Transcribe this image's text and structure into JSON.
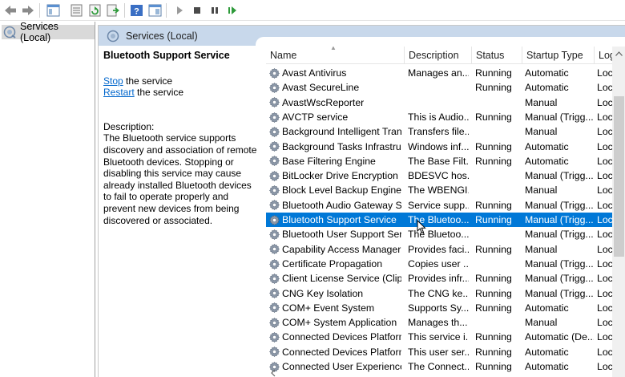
{
  "tree": {
    "root_label": "Services (Local)"
  },
  "header": {
    "title": "Services (Local)"
  },
  "details": {
    "service_name": "Bluetooth Support Service",
    "stop_link": "Stop",
    "stop_suffix": " the service",
    "restart_link": "Restart",
    "restart_suffix": " the service",
    "description_label": "Description:",
    "description_text": "The Bluetooth service supports discovery and association of remote Bluetooth devices.  Stopping or disabling this service may cause already installed Bluetooth devices to fail to operate properly and prevent new devices from being discovered or associated."
  },
  "columns": {
    "name": "Name",
    "description": "Description",
    "status": "Status",
    "startup_type": "Startup Type",
    "log_on_as": "Log"
  },
  "services": [
    {
      "name": "Avast Antivirus",
      "description": "Manages an...",
      "status": "Running",
      "startup": "Automatic",
      "logon": "Loc"
    },
    {
      "name": "Avast SecureLine",
      "description": "",
      "status": "Running",
      "startup": "Automatic",
      "logon": "Loc"
    },
    {
      "name": "AvastWscReporter",
      "description": "",
      "status": "",
      "startup": "Manual",
      "logon": "Loc"
    },
    {
      "name": "AVCTP service",
      "description": "This is Audio...",
      "status": "Running",
      "startup": "Manual (Trigg...",
      "logon": "Loc"
    },
    {
      "name": "Background Intelligent Tran...",
      "description": "Transfers file...",
      "status": "",
      "startup": "Manual",
      "logon": "Loc"
    },
    {
      "name": "Background Tasks Infrastruc...",
      "description": "Windows inf...",
      "status": "Running",
      "startup": "Automatic",
      "logon": "Loc"
    },
    {
      "name": "Base Filtering Engine",
      "description": "The Base Filt...",
      "status": "Running",
      "startup": "Automatic",
      "logon": "Loc"
    },
    {
      "name": "BitLocker Drive Encryption S...",
      "description": "BDESVC hos...",
      "status": "",
      "startup": "Manual (Trigg...",
      "logon": "Loc"
    },
    {
      "name": "Block Level Backup Engine S...",
      "description": "The WBENGI...",
      "status": "",
      "startup": "Manual",
      "logon": "Loc"
    },
    {
      "name": "Bluetooth Audio Gateway Se...",
      "description": "Service supp...",
      "status": "Running",
      "startup": "Manual (Trigg...",
      "logon": "Loc"
    },
    {
      "name": "Bluetooth Support Service",
      "description": "The Bluetoo...",
      "status": "Running",
      "startup": "Manual (Trigg...",
      "logon": "Loc",
      "selected": true
    },
    {
      "name": "Bluetooth User Support Serv...",
      "description": "The Bluetoo...",
      "status": "",
      "startup": "Manual (Trigg...",
      "logon": "Loc"
    },
    {
      "name": "Capability Access Manager S...",
      "description": "Provides faci...",
      "status": "Running",
      "startup": "Manual",
      "logon": "Loc"
    },
    {
      "name": "Certificate Propagation",
      "description": "Copies user ...",
      "status": "",
      "startup": "Manual (Trigg...",
      "logon": "Loc"
    },
    {
      "name": "Client License Service (ClipSV",
      "description": "Provides infr...",
      "status": "Running",
      "startup": "Manual (Trigg...",
      "logon": "Loc"
    },
    {
      "name": "CNG Key Isolation",
      "description": "The CNG ke...",
      "status": "Running",
      "startup": "Manual (Trigg...",
      "logon": "Loc"
    },
    {
      "name": "COM+ Event System",
      "description": "Supports Sy...",
      "status": "Running",
      "startup": "Automatic",
      "logon": "Loc"
    },
    {
      "name": "COM+ System Application",
      "description": "Manages th...",
      "status": "",
      "startup": "Manual",
      "logon": "Loc"
    },
    {
      "name": "Connected Devices Platform ...",
      "description": "This service i...",
      "status": "Running",
      "startup": "Automatic (De...",
      "logon": "Loc"
    },
    {
      "name": "Connected Devices Platform ...",
      "description": "This user ser...",
      "status": "Running",
      "startup": "Automatic",
      "logon": "Loc"
    },
    {
      "name": "Connected User Experiences ...",
      "description": "The Connect...",
      "status": "Running",
      "startup": "Automatic",
      "logon": "Loc"
    }
  ],
  "colors": {
    "header_bg": "#c8d8eb",
    "selection": "#0078d7",
    "link": "#0066cc"
  },
  "icons": {
    "toolbar": [
      "back-arrow-icon",
      "forward-arrow-icon",
      "show-hide-tree-icon",
      "properties-icon",
      "refresh-icon",
      "export-list-icon",
      "help-icon",
      "view-icon",
      "start-service-icon",
      "stop-service-icon",
      "pause-service-icon",
      "resume-service-icon"
    ],
    "service": "gear-icon"
  }
}
